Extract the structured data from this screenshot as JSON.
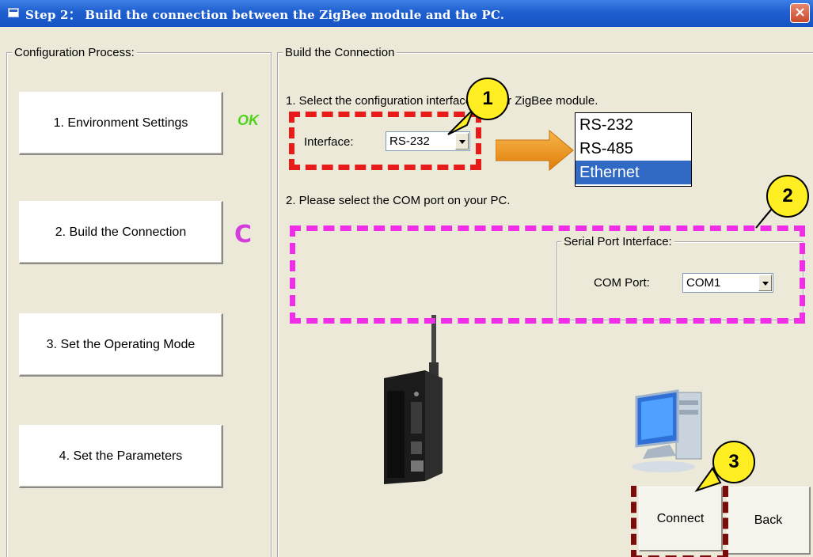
{
  "window": {
    "title": "Step 2： Build the connection between the ZigBee module and the PC.",
    "close_label": "×"
  },
  "left_panel": {
    "legend": "Configuration Process:",
    "steps": [
      {
        "label": "1. Environment Settings",
        "status": "OK"
      },
      {
        "label": "2. Build the Connection",
        "status": "C"
      },
      {
        "label": "3. Set the Operating Mode"
      },
      {
        "label": "4. Set the Parameters"
      }
    ]
  },
  "right_panel": {
    "legend": "Build the Connection",
    "instruction1": "1. Select the configuration interface of your ZigBee module.",
    "interface_label": "Interface:",
    "interface_value": "RS-232",
    "interface_options": [
      "RS-232",
      "RS-485",
      "Ethernet"
    ],
    "selected_option": "Ethernet",
    "instruction2": "2. Please select the COM port on your PC.",
    "serial_group_legend": "Serial Port Interface:",
    "com_port_label": "COM Port:",
    "com_port_value": "COM1",
    "connect_label": "Connect",
    "back_label": "Back"
  },
  "callouts": [
    "1",
    "2",
    "3"
  ],
  "colors": {
    "callout_fill": "#ffee22",
    "highlight_red": "#e81b1b",
    "highlight_magenta": "#f02ee8",
    "highlight_maroon": "#7a0c0c",
    "arrow_orange": "#f39a16",
    "selection_blue": "#316ac5"
  }
}
